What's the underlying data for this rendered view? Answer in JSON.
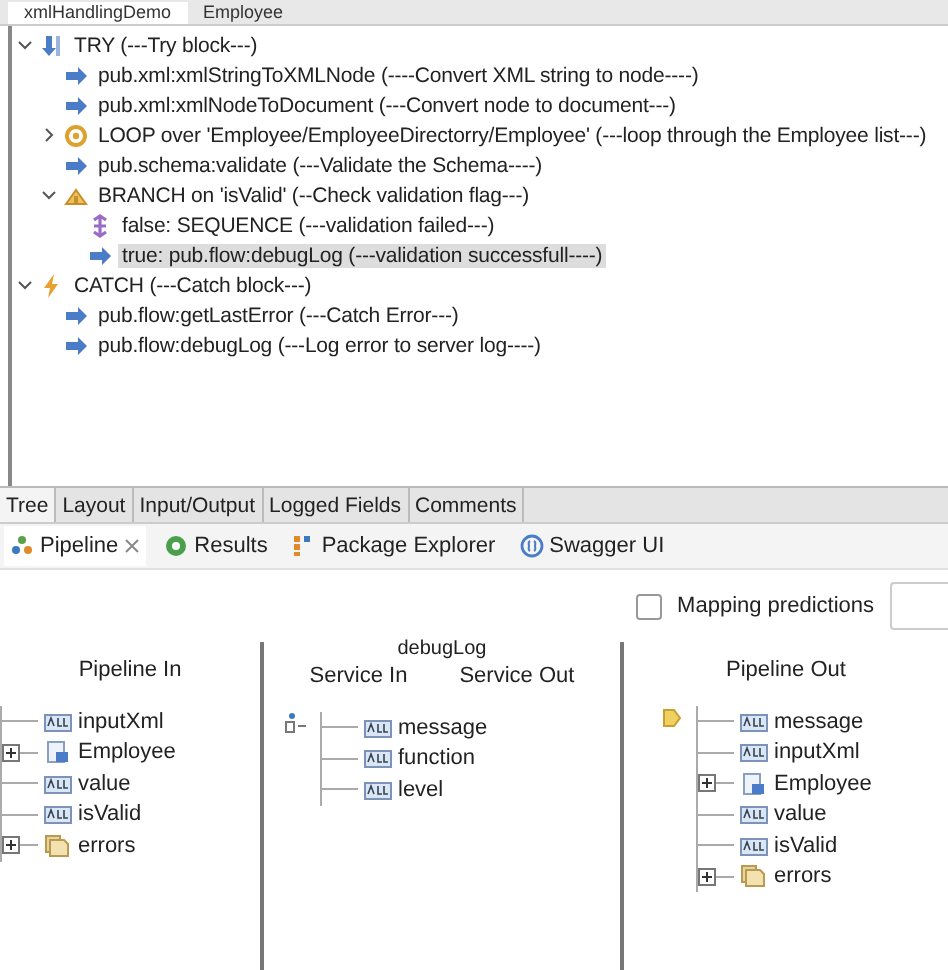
{
  "editor_tabs": [
    {
      "label": "xmlHandlingDemo",
      "selected": true
    },
    {
      "label": "Employee",
      "selected": false
    }
  ],
  "flow_tree": [
    {
      "kind": "try",
      "label": "TRY (---Try block---)",
      "expanded": true,
      "selected": false,
      "children": [
        {
          "kind": "invoke",
          "label": "pub.xml:xmlStringToXMLNode (----Convert XML string to node----)",
          "selected": false
        },
        {
          "kind": "invoke",
          "label": "pub.xml:xmlNodeToDocument (---Convert node to document---)",
          "selected": false
        },
        {
          "kind": "loop",
          "label": "LOOP over 'Employee/EmployeeDirectorry/Employee' (---loop through the Employee list---)",
          "expanded": false,
          "selected": false
        },
        {
          "kind": "invoke",
          "label": "pub.schema:validate (---Validate the Schema----)",
          "selected": false
        },
        {
          "kind": "branch",
          "label": "BRANCH on 'isValid' (--Check validation flag---)",
          "expanded": true,
          "selected": false,
          "children": [
            {
              "kind": "sequence",
              "label": "false: SEQUENCE (---validation failed---)",
              "selected": false
            },
            {
              "kind": "invoke",
              "label": "true: pub.flow:debugLog (---validation successfull----)",
              "selected": true
            }
          ]
        }
      ]
    },
    {
      "kind": "catch",
      "label": "CATCH (---Catch block---)",
      "expanded": true,
      "selected": false,
      "children": [
        {
          "kind": "invoke",
          "label": "pub.flow:getLastError (---Catch Error---)",
          "selected": false
        },
        {
          "kind": "invoke",
          "label": "pub.flow:debugLog (---Log error to server log----)",
          "selected": false
        }
      ]
    }
  ],
  "bottom_tabs": [
    {
      "label": "Tree",
      "selected": true
    },
    {
      "label": "Layout",
      "selected": false
    },
    {
      "label": "Input/Output",
      "selected": false
    },
    {
      "label": "Logged Fields",
      "selected": false
    },
    {
      "label": "Comments",
      "selected": false
    }
  ],
  "view_tabs": [
    {
      "kind": "pipeline",
      "label": "Pipeline",
      "selected": true
    },
    {
      "kind": "results",
      "label": "Results",
      "selected": false
    },
    {
      "kind": "packages",
      "label": "Package Explorer",
      "selected": false
    },
    {
      "kind": "swagger",
      "label": "Swagger UI",
      "selected": false
    }
  ],
  "mapping_predictions": {
    "label": "Mapping predictions",
    "checked": false
  },
  "pipeline": {
    "service_name": "debugLog",
    "pipeline_in": {
      "title": "Pipeline In",
      "fields": [
        {
          "kind": "string",
          "name": "inputXml",
          "has_children": false
        },
        {
          "kind": "document",
          "name": "Employee",
          "has_children": true
        },
        {
          "kind": "string",
          "name": "value",
          "has_children": false
        },
        {
          "kind": "string",
          "name": "isValid",
          "has_children": false
        },
        {
          "kind": "document_list",
          "name": "errors",
          "has_children": true
        }
      ]
    },
    "service_in": {
      "title": "Service In",
      "fields": [
        {
          "kind": "string",
          "name": "message",
          "has_children": false
        },
        {
          "kind": "string",
          "name": "function",
          "has_children": false
        },
        {
          "kind": "string",
          "name": "level",
          "has_children": false
        }
      ]
    },
    "service_out": {
      "title": "Service Out"
    },
    "pipeline_out": {
      "title": "Pipeline Out",
      "fields": [
        {
          "kind": "string",
          "name": "message",
          "has_children": false
        },
        {
          "kind": "string",
          "name": "inputXml",
          "has_children": false
        },
        {
          "kind": "document",
          "name": "Employee",
          "has_children": true
        },
        {
          "kind": "string",
          "name": "value",
          "has_children": false
        },
        {
          "kind": "string",
          "name": "isValid",
          "has_children": false
        },
        {
          "kind": "document_list",
          "name": "errors",
          "has_children": true
        }
      ]
    }
  }
}
